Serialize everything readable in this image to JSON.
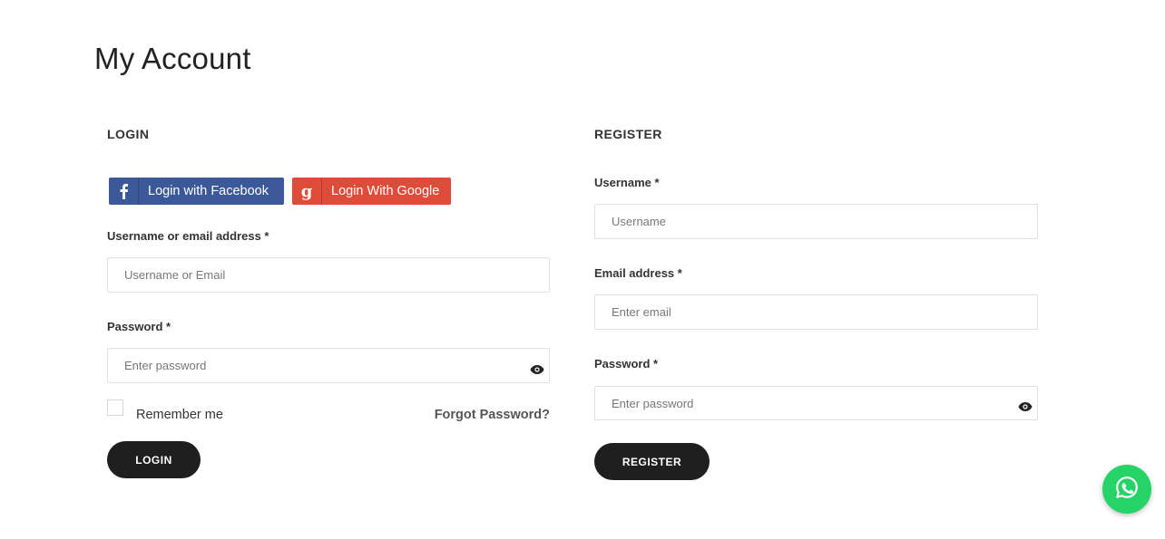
{
  "page": {
    "title": "My Account"
  },
  "login": {
    "heading": "LOGIN",
    "facebook_label": "Login with Facebook",
    "google_label": "Login With Google",
    "username_label": "Username or email address *",
    "username_placeholder": "Username or Email",
    "password_label": "Password *",
    "password_placeholder": "Enter password",
    "remember_label": "Remember me",
    "forgot_label": "Forgot Password?",
    "submit_label": "LOGIN"
  },
  "register": {
    "heading": "REGISTER",
    "username_label": "Username *",
    "username_placeholder": "Username",
    "email_label": "Email address *",
    "email_placeholder": "Enter email",
    "password_label": "Password *",
    "password_placeholder": "Enter password",
    "submit_label": "REGISTER"
  },
  "icons": {
    "facebook": "facebook-icon",
    "google": "google-icon",
    "eye": "eye-icon",
    "whatsapp": "whatsapp-icon"
  },
  "colors": {
    "facebook": "#3b5998",
    "google": "#dd4b39",
    "button_dark": "#1f1f1f",
    "whatsapp": "#25d366"
  }
}
